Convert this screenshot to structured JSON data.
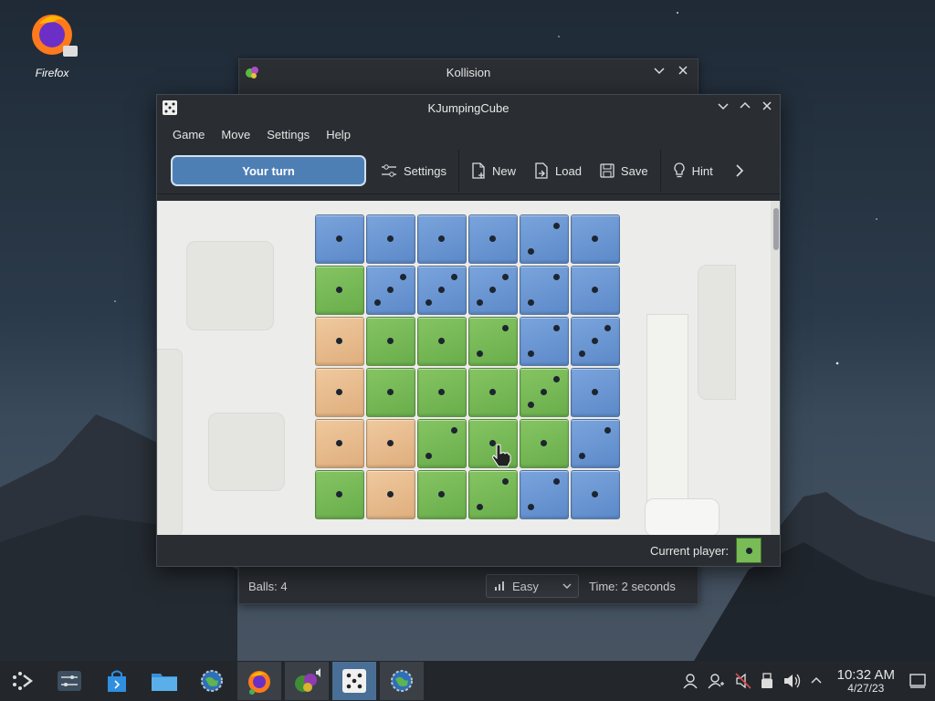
{
  "desktop": {
    "icon_label": "Firefox"
  },
  "background_window": {
    "title": "Kollision",
    "status": {
      "balls": "Balls: 4",
      "difficulty": "Easy",
      "time": "Time: 2 seconds"
    }
  },
  "main_window": {
    "title": "KJumpingCube",
    "menu": [
      "Game",
      "Move",
      "Settings",
      "Help"
    ],
    "toolbar": {
      "turn_label": "Your turn",
      "settings_label": "Settings",
      "new_label": "New",
      "load_label": "Load",
      "save_label": "Save",
      "hint_label": "Hint"
    },
    "board": {
      "rows": [
        [
          {
            "c": "blue",
            "n": 1
          },
          {
            "c": "blue",
            "n": 1
          },
          {
            "c": "blue",
            "n": 1
          },
          {
            "c": "blue",
            "n": 1
          },
          {
            "c": "blue",
            "n": 2
          },
          {
            "c": "blue",
            "n": 1
          }
        ],
        [
          {
            "c": "green",
            "n": 1
          },
          {
            "c": "blue",
            "n": 3
          },
          {
            "c": "blue",
            "n": 3
          },
          {
            "c": "blue",
            "n": 3
          },
          {
            "c": "blue",
            "n": 2
          },
          {
            "c": "blue",
            "n": 1
          }
        ],
        [
          {
            "c": "orange",
            "n": 1
          },
          {
            "c": "green",
            "n": 1
          },
          {
            "c": "green",
            "n": 1
          },
          {
            "c": "green",
            "n": 2
          },
          {
            "c": "blue",
            "n": 2
          },
          {
            "c": "blue",
            "n": 3
          }
        ],
        [
          {
            "c": "orange",
            "n": 1
          },
          {
            "c": "green",
            "n": 1
          },
          {
            "c": "green",
            "n": 1
          },
          {
            "c": "green",
            "n": 1
          },
          {
            "c": "green",
            "n": 3
          },
          {
            "c": "blue",
            "n": 1
          }
        ],
        [
          {
            "c": "orange",
            "n": 1
          },
          {
            "c": "orange",
            "n": 1
          },
          {
            "c": "green",
            "n": 2
          },
          {
            "c": "green",
            "n": 1
          },
          {
            "c": "green",
            "n": 1
          },
          {
            "c": "blue",
            "n": 2
          }
        ],
        [
          {
            "c": "green",
            "n": 1
          },
          {
            "c": "orange",
            "n": 1
          },
          {
            "c": "green",
            "n": 1
          },
          {
            "c": "green",
            "n": 2
          },
          {
            "c": "blue",
            "n": 2
          },
          {
            "c": "blue",
            "n": 1
          }
        ]
      ]
    },
    "status": {
      "current_player_label": "Current player:"
    }
  },
  "colors": {
    "blue": "#6a95d3",
    "green": "#77b957",
    "orange": "#e8bd8f",
    "turn_button": "#4d7fb5"
  },
  "taskbar": {
    "items": [
      "application-launcher-icon",
      "system-settings-icon",
      "discover-icon",
      "dolphin-icon",
      "settings-globe-icon",
      "firefox-icon",
      "kollision-icon",
      "kjumpingcube-icon",
      "globe-icon"
    ],
    "clock_time": "10:32 AM",
    "clock_date": "4/27/23"
  }
}
